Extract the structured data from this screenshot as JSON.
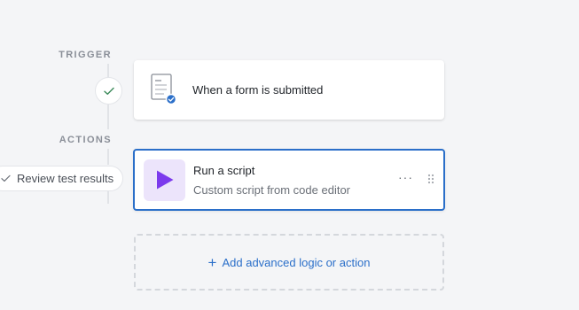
{
  "labels": {
    "trigger": "TRIGGER",
    "actions": "ACTIONS"
  },
  "review": {
    "label": "Review test results",
    "icon": "check-icon"
  },
  "trigger_step": {
    "title": "When a form is submitted",
    "icon": "form-icon",
    "status_icon": "check-icon"
  },
  "action_step": {
    "title": "Run a script",
    "subtitle": "Custom script from code editor",
    "icon": "play-icon",
    "more_label": "···"
  },
  "add_step": {
    "plus": "+",
    "label": "Add advanced logic or action"
  },
  "colors": {
    "accent": "#2b6fc9",
    "play": "#7c3aed",
    "play_bg": "#ece4fb",
    "check": "#3b8a5a"
  }
}
